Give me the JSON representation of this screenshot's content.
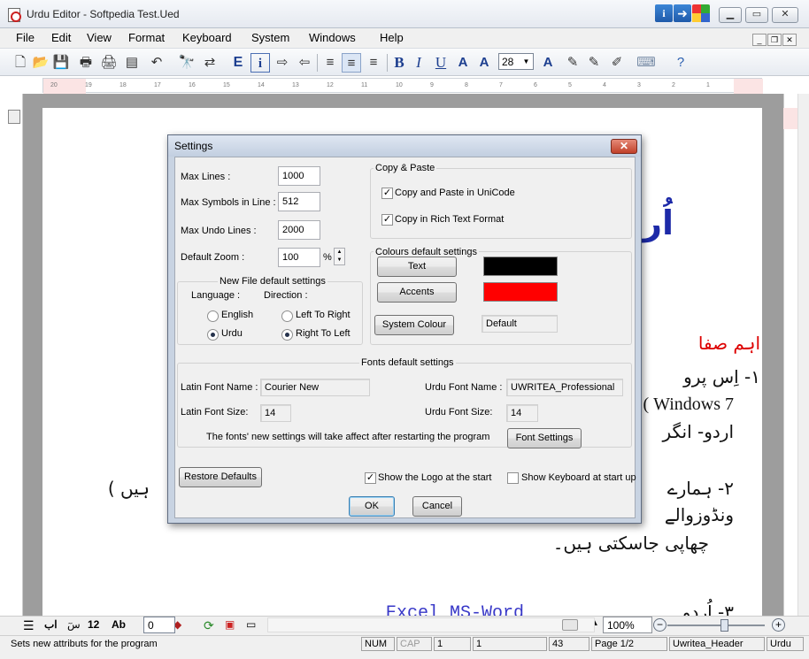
{
  "window": {
    "title": "Urdu Editor - Softpedia Test.Ued"
  },
  "menu": [
    "File",
    "Edit",
    "View",
    "Format",
    "Keyboard",
    "System",
    "Windows",
    "Help"
  ],
  "toolbar": {
    "font_size": "28",
    "bold": "B",
    "italic": "I",
    "underline": "U",
    "e_icon": "E"
  },
  "ruler": {
    "ticks": [
      "20",
      "19",
      "18",
      "17",
      "16",
      "15",
      "14",
      "13",
      "12",
      "11",
      "10",
      "9",
      "8",
      "7",
      "6",
      "5",
      "4",
      "3",
      "2",
      "1"
    ]
  },
  "document": {
    "heading": "اُرد           پنے",
    "red_line": "اہم صفا",
    "line1": "۱- اِس پرو",
    "line2": "Windows 7 )",
    "line3": "اردو- انگر",
    "line4": "۲- ہمارے",
    "line4b": "ہیں )",
    "line5": "ونڈوزوالے",
    "line6": "چھاپی جاسکتی ہیں۔",
    "line7": "۳- اُردو",
    "latin_bottom": "Excel MS-Word"
  },
  "settings": {
    "title": "Settings",
    "close_label": "✕",
    "max_lines_label": "Max Lines :",
    "max_lines_value": "1000",
    "max_symbols_label": "Max Symbols in Line :",
    "max_symbols_value": "512",
    "max_undo_label": "Max Undo Lines :",
    "max_undo_value": "2000",
    "default_zoom_label": "Default Zoom :",
    "default_zoom_value": "100",
    "zoom_unit": "%",
    "copy_paste_title": "Copy & Paste",
    "copy_unicode_label": "Copy and Paste in UniCode",
    "copy_unicode_checked": true,
    "copy_rtf_label": "Copy in Rich Text Format",
    "copy_rtf_checked": true,
    "new_file_title": "New File default settings",
    "language_label": "Language :",
    "direction_label": "Direction :",
    "english_label": "English",
    "urdu_label": "Urdu",
    "ltr_label": "Left To Right",
    "rtl_label": "Right To Left",
    "colours_title": "Colours default settings",
    "text_button": "Text",
    "accents_button": "Accents",
    "text_color": "#000000",
    "accent_color": "#ff0000",
    "system_colour_button": "System Colour",
    "system_colour_value": "Default",
    "fonts_title": "Fonts default settings",
    "latin_font_name_label": "Latin Font Name :",
    "latin_font_name_value": "Courier New",
    "latin_font_size_label": "Latin Font Size:",
    "latin_font_size_value": "14",
    "urdu_font_name_label": "Urdu Font Name :",
    "urdu_font_name_value": "UWRITEA_Professional",
    "urdu_font_size_label": "Urdu Font Size:",
    "urdu_font_size_value": "14",
    "fonts_note": "The fonts' new settings will take affect after restarting the program",
    "font_settings_button": "Font Settings",
    "restore_button": "Restore Defaults",
    "show_logo_label": "Show the Logo at the start",
    "show_logo_checked": true,
    "show_keyboard_label": "Show Keyboard at start up",
    "show_keyboard_checked": false,
    "ok_button": "OK",
    "cancel_button": "Cancel"
  },
  "bottombar": {
    "urdu_ab": "اب",
    "urdu_b": "سٓ",
    "num12": "12",
    "ab": "Ab",
    "zoom_input": "0",
    "zoom_percent": "100%"
  },
  "status": {
    "message": "Sets new attributs for the program",
    "num": "NUM",
    "cap": "CAP",
    "line": "1",
    "col": "1",
    "chars": "43",
    "page": "Page 1/2",
    "style": "Uwritea_Header",
    "lang": "Urdu"
  }
}
